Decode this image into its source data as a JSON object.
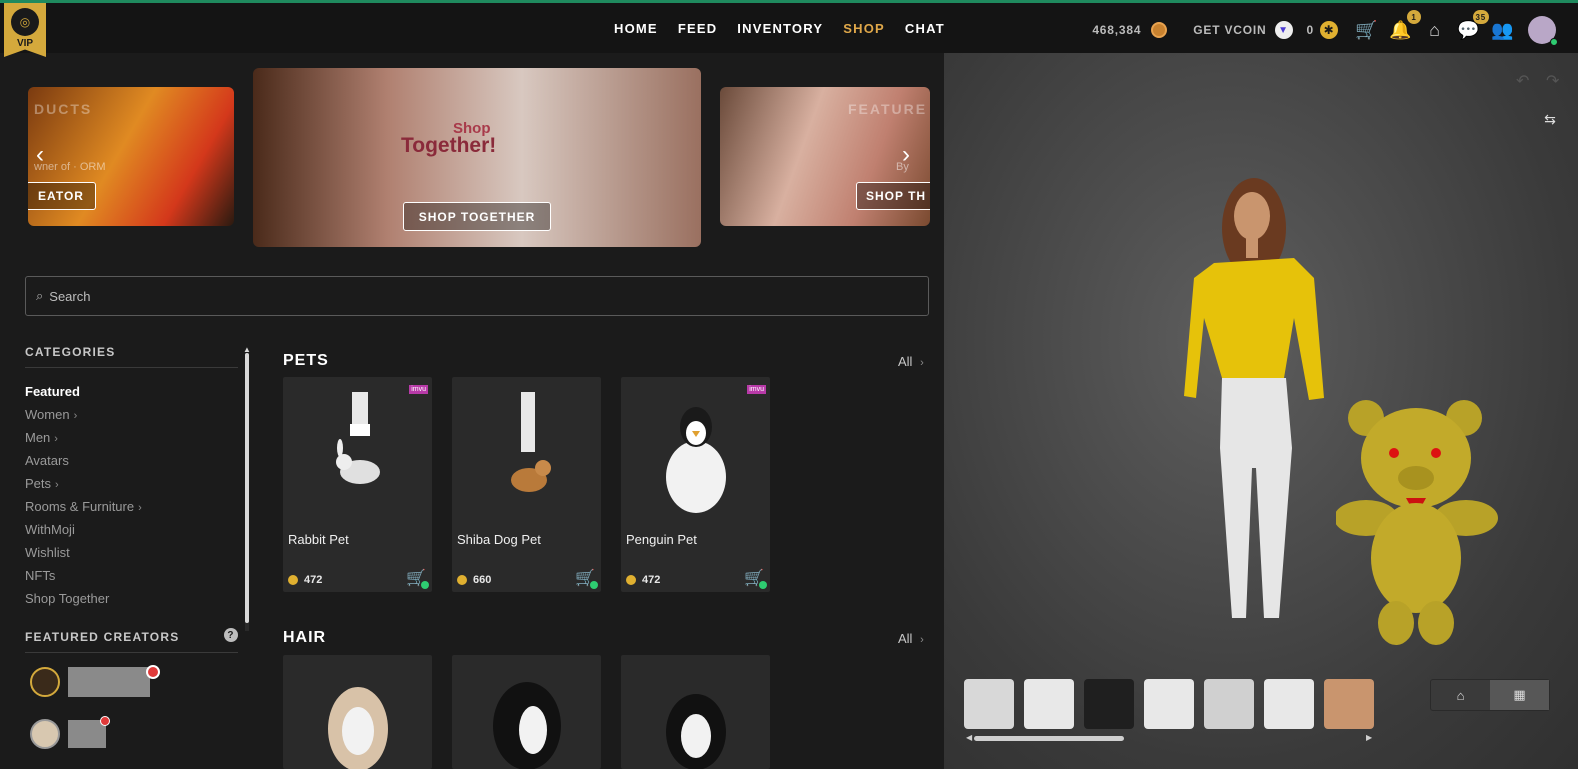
{
  "nav": {
    "vip_label": "VIP",
    "links": [
      "HOME",
      "FEED",
      "INVENTORY",
      "SHOP",
      "CHAT"
    ],
    "active": "SHOP",
    "credits": "468,384",
    "get_vcoin": "GET VCOIN",
    "vcoin_balance": "0",
    "notifications_badge": "1",
    "messages_badge": "35"
  },
  "banners": {
    "left_word": "DUCTS",
    "left_sub": "wner of · ORM",
    "left_button": "EATOR",
    "center_shop": "Shop",
    "center_together": "Together!",
    "center_button": "SHOP TOGETHER",
    "right_word": "FEATURE",
    "right_sub": "By",
    "right_button": "SHOP TH"
  },
  "search": {
    "placeholder": "Search"
  },
  "sidebar": {
    "categories_title": "CATEGORIES",
    "categories": [
      "Featured",
      "Women",
      "Men",
      "Avatars",
      "Pets",
      "Rooms & Furniture",
      "WithMoji",
      "Wishlist",
      "NFTs",
      "Shop Together"
    ],
    "featured_creators_title": "FEATURED CREATORS",
    "help": "?"
  },
  "sections": {
    "pets": {
      "title": "PETS",
      "all": "All",
      "items": [
        {
          "name": "Rabbit Pet",
          "price": "472"
        },
        {
          "name": "Shiba Dog Pet",
          "price": "660"
        },
        {
          "name": "Penguin Pet",
          "price": "472"
        }
      ]
    },
    "hair": {
      "title": "HAIR",
      "all": "All"
    }
  },
  "colors": {
    "accent": "#e0a84a",
    "vip": "#d4a93c",
    "topline": "#1f8a5e"
  },
  "icons": {
    "credits": "credit-coin-icon",
    "vcoin": "vcoin-icon",
    "star": "star-coin-icon",
    "cart": "cart-icon",
    "bell": "bell-icon",
    "home": "home-icon",
    "chat": "chat-icon",
    "friends": "friends-icon"
  }
}
